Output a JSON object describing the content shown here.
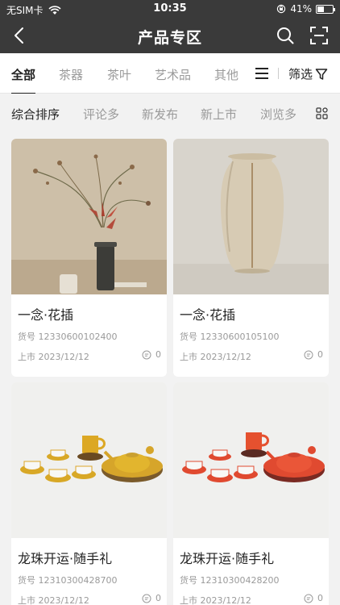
{
  "status": {
    "carrier": "无SIM卡",
    "time": "10:35",
    "battery": "41%",
    "battery_level": 0.41
  },
  "nav": {
    "title": "产品专区"
  },
  "categories": [
    "全部",
    "茶器",
    "茶叶",
    "艺术品",
    "其他"
  ],
  "filter_label": "筛选",
  "sort_options": [
    "综合排序",
    "评论多",
    "新发布",
    "新上市",
    "浏览多"
  ],
  "products": [
    {
      "name": "一念·花插",
      "sku": "货号 12330600102400",
      "date": "上市 2023/12/12",
      "comments": "0"
    },
    {
      "name": "一念·花插",
      "sku": "货号 12330600105100",
      "date": "上市 2023/12/12",
      "comments": "0"
    },
    {
      "name": "龙珠开运·随手礼",
      "sku": "货号 12310300428700",
      "date": "上市 2023/12/12",
      "comments": "0"
    },
    {
      "name": "龙珠开运·随手礼",
      "sku": "货号 12310300428200",
      "date": "上市 2023/12/12",
      "comments": "0"
    }
  ]
}
